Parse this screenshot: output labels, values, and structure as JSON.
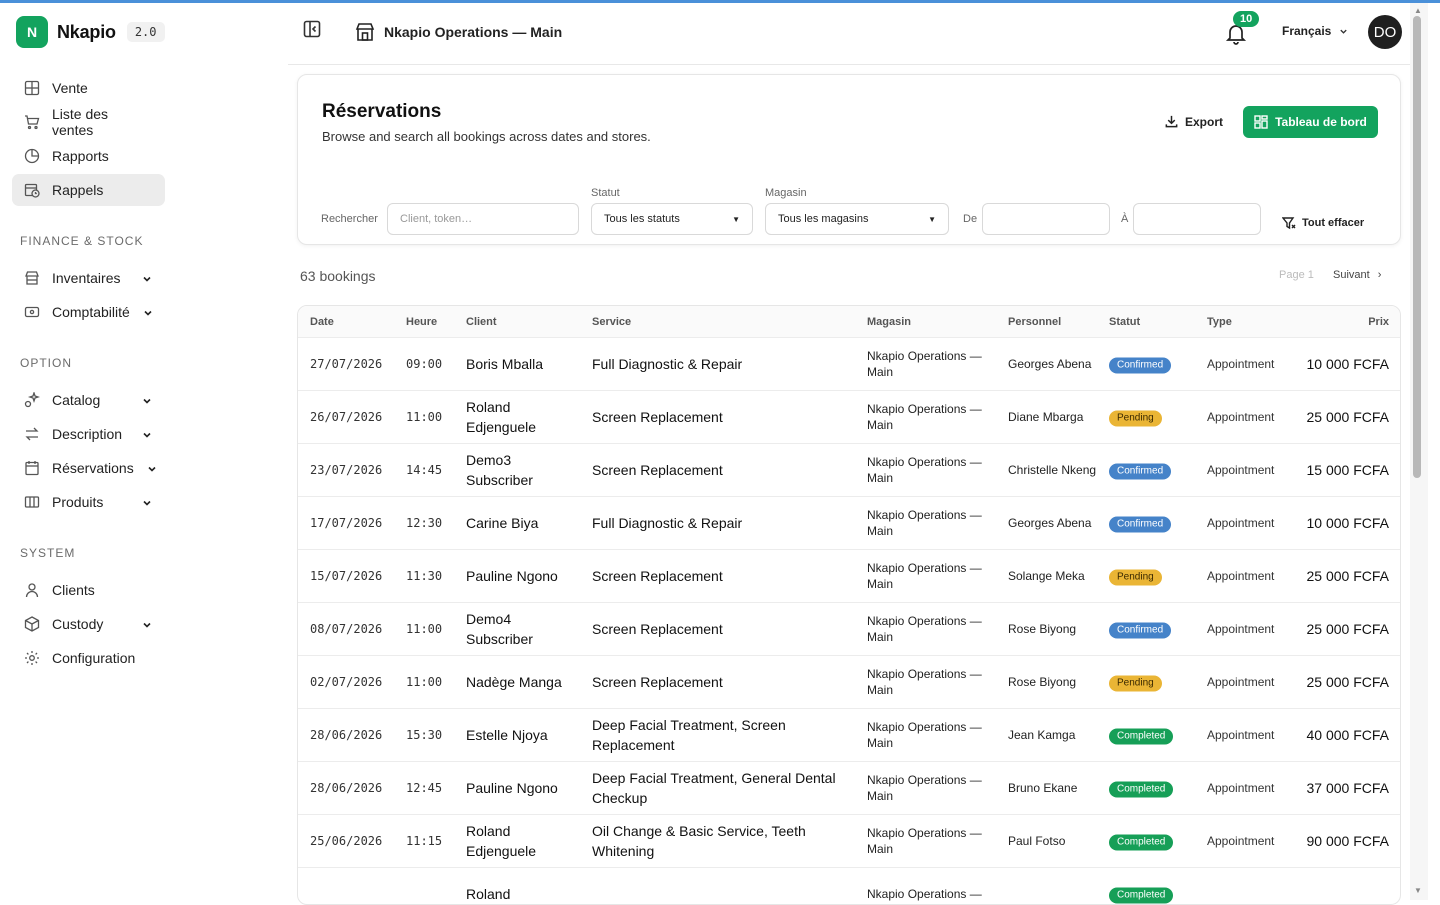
{
  "app": {
    "name": "Nkapio",
    "version": "2.0",
    "logo_letter": "N",
    "brand_color": "#13a35e"
  },
  "sidebar": {
    "main_items": [
      {
        "label": "Vente",
        "icon": "pos-grid-icon"
      },
      {
        "label": "Liste des ventes",
        "icon": "cart-icon"
      },
      {
        "label": "Rapports",
        "icon": "pie-chart-icon"
      },
      {
        "label": "Rappels",
        "icon": "calendar-clock-icon",
        "active": true
      }
    ],
    "sections": [
      {
        "title": "FINANCE & STOCK",
        "items": [
          {
            "label": "Inventaires",
            "icon": "store-icon",
            "expandable": true
          },
          {
            "label": "Comptabilité",
            "icon": "wallet-icon",
            "expandable": true
          }
        ]
      },
      {
        "title": "OPTION",
        "items": [
          {
            "label": "Catalog",
            "icon": "sparkles-icon",
            "expandable": true
          },
          {
            "label": "Description",
            "icon": "swap-icon",
            "expandable": true
          },
          {
            "label": "Réservations",
            "icon": "calendar-icon",
            "expandable": true
          },
          {
            "label": "Produits",
            "icon": "boxes-icon",
            "expandable": true
          }
        ]
      },
      {
        "title": "SYSTEM",
        "items": [
          {
            "label": "Clients",
            "icon": "user-icon",
            "expandable": false
          },
          {
            "label": "Custody",
            "icon": "package-icon",
            "expandable": true
          },
          {
            "label": "Configuration",
            "icon": "gear-icon",
            "expandable": false
          }
        ]
      }
    ]
  },
  "header": {
    "store_name": "Nkapio Operations — Main",
    "notifications": "10",
    "language": "Français",
    "avatar": "DO"
  },
  "page": {
    "title": "Réservations",
    "subtitle": "Browse and search all bookings across dates and stores.",
    "export_label": "Export",
    "dashboard_label": "Tableau de bord"
  },
  "filters": {
    "search_label": "Rechercher",
    "search_placeholder": "Client, token…",
    "status_label": "Statut",
    "status_value": "Tous les statuts",
    "store_label": "Magasin",
    "store_value": "Tous les magasins",
    "from_label": "De",
    "to_label": "À",
    "clear_label": "Tout effacer"
  },
  "results": {
    "count_text": "63 bookings",
    "page_text": "Page 1",
    "next_text": "Suivant"
  },
  "table": {
    "columns": [
      "Date",
      "Heure",
      "Client",
      "Service",
      "Magasin",
      "Personnel",
      "Statut",
      "Type",
      "Prix"
    ],
    "rows": [
      {
        "date": "27/07/2026",
        "time": "09:00",
        "client": "Boris Mballa",
        "service": "Full Diagnostic & Repair",
        "store": "Nkapio Operations — Main",
        "staff": "Georges Abena",
        "status": "Confirmed",
        "type": "Appointment",
        "price": "10 000 FCFA"
      },
      {
        "date": "26/07/2026",
        "time": "11:00",
        "client": "Roland Edjenguele",
        "service": "Screen Replacement",
        "store": "Nkapio Operations — Main",
        "staff": "Diane Mbarga",
        "status": "Pending",
        "type": "Appointment",
        "price": "25 000 FCFA"
      },
      {
        "date": "23/07/2026",
        "time": "14:45",
        "client": "Demo3 Subscriber",
        "service": "Screen Replacement",
        "store": "Nkapio Operations — Main",
        "staff": "Christelle Nkeng",
        "status": "Confirmed",
        "type": "Appointment",
        "price": "15 000 FCFA"
      },
      {
        "date": "17/07/2026",
        "time": "12:30",
        "client": "Carine Biya",
        "service": "Full Diagnostic & Repair",
        "store": "Nkapio Operations — Main",
        "staff": "Georges Abena",
        "status": "Confirmed",
        "type": "Appointment",
        "price": "10 000 FCFA"
      },
      {
        "date": "15/07/2026",
        "time": "11:30",
        "client": "Pauline Ngono",
        "service": "Screen Replacement",
        "store": "Nkapio Operations — Main",
        "staff": "Solange Meka",
        "status": "Pending",
        "type": "Appointment",
        "price": "25 000 FCFA"
      },
      {
        "date": "08/07/2026",
        "time": "11:00",
        "client": "Demo4 Subscriber",
        "service": "Screen Replacement",
        "store": "Nkapio Operations — Main",
        "staff": "Rose Biyong",
        "status": "Confirmed",
        "type": "Appointment",
        "price": "25 000 FCFA"
      },
      {
        "date": "02/07/2026",
        "time": "11:00",
        "client": "Nadège Manga",
        "service": "Screen Replacement",
        "store": "Nkapio Operations — Main",
        "staff": "Rose Biyong",
        "status": "Pending",
        "type": "Appointment",
        "price": "25 000 FCFA"
      },
      {
        "date": "28/06/2026",
        "time": "15:30",
        "client": "Estelle Njoya",
        "service": "Deep Facial Treatment, Screen Replacement",
        "store": "Nkapio Operations — Main",
        "staff": "Jean Kamga",
        "status": "Completed",
        "type": "Appointment",
        "price": "40 000 FCFA"
      },
      {
        "date": "28/06/2026",
        "time": "12:45",
        "client": "Pauline Ngono",
        "service": "Deep Facial Treatment, General Dental Checkup",
        "store": "Nkapio Operations — Main",
        "staff": "Bruno Ekane",
        "status": "Completed",
        "type": "Appointment",
        "price": "37 000 FCFA"
      },
      {
        "date": "25/06/2026",
        "time": "11:15",
        "client": "Roland Edjenguele",
        "service": "Oil Change & Basic Service, Teeth Whitening",
        "store": "Nkapio Operations — Main",
        "staff": "Paul Fotso",
        "status": "Completed",
        "type": "Appointment",
        "price": "90 000 FCFA"
      },
      {
        "date": "",
        "time": "",
        "client": "Roland",
        "service": "",
        "store": "Nkapio Operations —",
        "staff": "",
        "status": "Completed",
        "type": "",
        "price": ""
      }
    ]
  }
}
